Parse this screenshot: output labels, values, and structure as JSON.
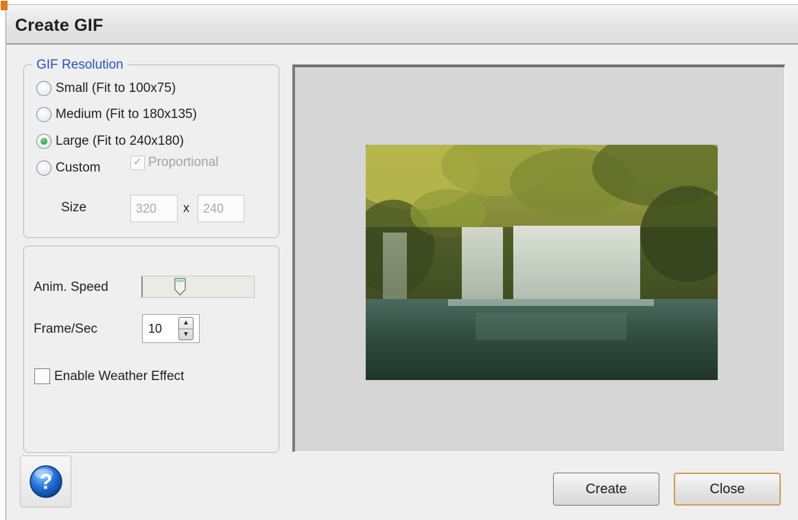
{
  "window": {
    "title": "Create GIF"
  },
  "resolution_group": {
    "legend": "GIF Resolution",
    "options": [
      {
        "label": "Small (Fit to 100x75)",
        "selected": false
      },
      {
        "label": "Medium (Fit to 180x135)",
        "selected": false
      },
      {
        "label": "Large (Fit to 240x180)",
        "selected": true
      },
      {
        "label": "Custom",
        "selected": false
      }
    ],
    "proportional": {
      "label": "Proportional",
      "checked": true,
      "enabled": false
    },
    "size": {
      "label": "Size",
      "width": "320",
      "separator": "x",
      "height": "240"
    }
  },
  "animation_group": {
    "speed_label": "Anim. Speed",
    "speed_level": 0.27,
    "fps_label": "Frame/Sec",
    "fps_value": "10",
    "weather": {
      "label": "Enable Weather Effect",
      "checked": false
    }
  },
  "preview": {
    "image": "waterfall-forest-photo"
  },
  "buttons": {
    "create": "Create",
    "close": "Close",
    "help_icon": "question-mark-icon"
  },
  "colors": {
    "legend": "#2a52be",
    "radio_selected": "#1f8a2e",
    "close_focus_border": "#d19b48"
  }
}
